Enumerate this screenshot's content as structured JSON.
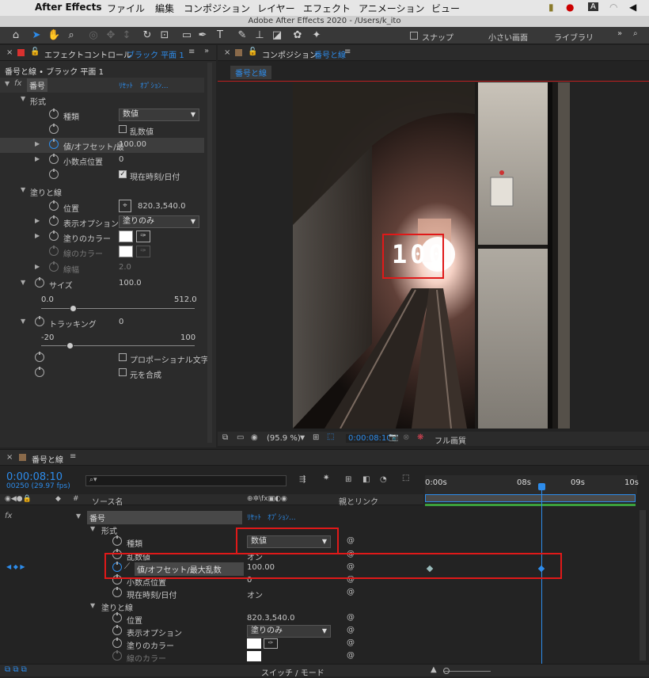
{
  "menubar": {
    "app": "After Effects",
    "items": [
      "ファイル",
      "編集",
      "コンポジション",
      "レイヤー",
      "エフェクト",
      "アニメーション",
      "ビュー"
    ]
  },
  "window_title": "Adobe After Effects 2020 - /Users/k_ito",
  "toolbar": {
    "snap_label": "スナップ",
    "workspace1": "小さい画面",
    "workspace2": "ライブラリ"
  },
  "effect_controls": {
    "tab_label": "エフェクトコントロール",
    "tab_layer": "ブラック 平面 1",
    "breadcrumb": "番号と線 • ブラック 平面 1",
    "effect_name": "番号",
    "reset": "ﾘｾｯﾄ",
    "options": "ｵﾌﾟｼｮﾝ...",
    "group_format": "形式",
    "type_label": "種類",
    "type_value": "数値",
    "random_label": "乱数値",
    "value_label": "値/オフセット/最",
    "value_value": "100.00",
    "decimal_label": "小数点位置",
    "decimal_value": "0",
    "datetime_label": "現在時刻/日付",
    "group_fill": "塗りと線",
    "position_label": "位置",
    "position_value": "820.3,540.0",
    "display_label": "表示オプション",
    "display_value": "塗りのみ",
    "fill_color_label": "塗りのカラー",
    "stroke_color_label": "線のカラー",
    "stroke_width_label": "線幅",
    "stroke_width_value": "2.0",
    "size_label": "サイズ",
    "size_value": "100.0",
    "size_min": "0.0",
    "size_max": "512.0",
    "tracking_label": "トラッキング",
    "tracking_value": "0",
    "tracking_min": "-20",
    "tracking_max": "100",
    "proportional_label": "プロポーショナル文字",
    "composite_label": "元を合成"
  },
  "composition": {
    "tab_label": "コンポジション",
    "tab_comp": "番号と線",
    "sub_tab": "番号と線",
    "overlay_number": "100",
    "zoom": "(95.9 %)",
    "time": "0:00:08:10",
    "quality": "フル画質"
  },
  "timeline": {
    "tab": "番号と線",
    "timecode": "0:00:08:10",
    "frames": "00250 (29.97 fps)",
    "search_placeholder": "",
    "col_source": "ソース名",
    "col_parent": "親とリンク",
    "ruler": [
      "0:00s",
      "08s",
      "09s",
      "10s"
    ],
    "rows": {
      "effect": "番号",
      "reset": "ﾘｾｯﾄ",
      "options": "ｵﾌﾟｼｮﾝ...",
      "format": "形式",
      "type_label": "種類",
      "type_value": "数値",
      "random_label": "乱数値",
      "random_value": "オン",
      "value_label": "値/オフセット/最大乱数",
      "value_value": "100.00",
      "decimal_label": "小数点位置",
      "decimal_value": "0",
      "datetime_label": "現在時刻/日付",
      "datetime_value": "オン",
      "fill": "塗りと線",
      "position_label": "位置",
      "position_value": "820.3,540.0",
      "display_label": "表示オプション",
      "display_value": "塗りのみ",
      "fill_color_label": "塗りのカラー",
      "stroke_color_label": "線のカラー"
    },
    "footer": "スイッチ / モード"
  },
  "colors": {
    "accent": "#2d8ceb",
    "highlight": "#e01919",
    "panel": "#2b2b2b"
  }
}
